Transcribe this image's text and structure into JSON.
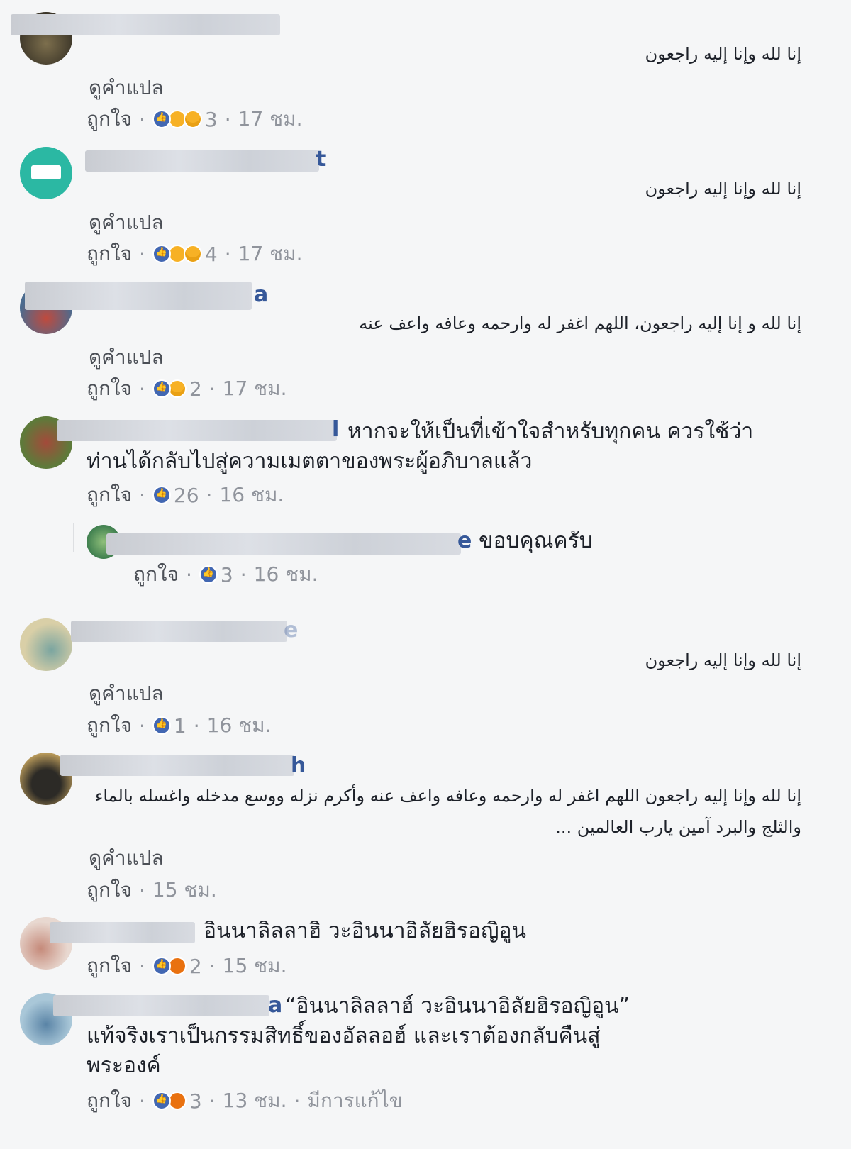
{
  "comments": [
    {
      "name_tail": "",
      "avatar_colors": [
        "#3b3528",
        "#7d6f4d"
      ],
      "arabic": "إنا لله وإنا إليه راجعون",
      "translate": "ดูคำแปล",
      "like": "ถูกใจ",
      "reactions": [
        "like",
        "haha",
        "sad"
      ],
      "count": "3",
      "time": "17 ชม."
    },
    {
      "name_tail": "t",
      "avatar_colors": [
        "#2bb8a3",
        "#ffffff"
      ],
      "arabic": "إنا لله وإنا إليه راجعون",
      "translate": "ดูคำแปล",
      "like": "ถูกใจ",
      "reactions": [
        "like",
        "haha",
        "sad"
      ],
      "count": "4",
      "time": "17 ชม."
    },
    {
      "name_tail": "a",
      "avatar_colors": [
        "#4b6b8f",
        "#c04a3d"
      ],
      "arabic": "إنا لله و إنا إليه راجعون، اللهم اغفر له وارحمه وعافه واعف عنه",
      "translate": "ดูคำแปล",
      "like": "ถูกใจ",
      "reactions": [
        "like",
        "sad"
      ],
      "count": "2",
      "time": "17 ชม."
    },
    {
      "name_tail": "l",
      "avatar_colors": [
        "#5e7a3a",
        "#a34a3a"
      ],
      "text": "หากจะให้เป็นที่เข้าใจสำหรับทุกคน ควรใช้ว่า ท่านได้กลับไปสู่ความเมตตาของพระผู้อภิบาลแล้ว",
      "like": "ถูกใจ",
      "reactions": [
        "like"
      ],
      "count": "26",
      "time": "16 ชม.",
      "reply": {
        "name_tail": "e",
        "text": "ขอบคุณครับ",
        "like": "ถูกใจ",
        "reactions": [
          "like"
        ],
        "count": "3",
        "time": "16 ชม."
      }
    },
    {
      "name_tail": "e",
      "avatar_colors": [
        "#d9cfa7",
        "#7aa5a0"
      ],
      "arabic": "إنا لله وإنا إليه راجعون",
      "translate": "ดูคำแปล",
      "like": "ถูกใจ",
      "reactions": [
        "like"
      ],
      "count": "1",
      "time": "16 ชม."
    },
    {
      "name_tail": "h",
      "avatar_colors": [
        "#2c2a26",
        "#b99a5a"
      ],
      "arabic": "إنا لله وإنا إليه راجعون اللهم اغفر له وارحمه وعافه واعف عنه وأكرم نزله ووسع مدخله واغسله بالماء والثلج والبرد آمين يارب العالمين ...",
      "translate": "ดูคำแปล",
      "like": "ถูกใจ",
      "reactions": [],
      "count": "",
      "time": "15 ชม."
    },
    {
      "name_tail": "",
      "avatar_colors": [
        "#e8d8d0",
        "#c58a7a"
      ],
      "text": "อินนาลิลลาฮิ วะอินนาอิลัยฮิรอญิอูน",
      "like": "ถูกใจ",
      "reactions": [
        "like",
        "angry"
      ],
      "count": "2",
      "time": "15 ชม."
    },
    {
      "name_tail": "a",
      "avatar_colors": [
        "#a9c7d8",
        "#5a84a6"
      ],
      "text": "“อินนาลิลลาฮ์ วะอินนาอิลัยฮิรอญิอูน” แท้จริงเราเป็นกรรมสิทธิ์ของอัลลอฮ์ และเราต้องกลับคืนสู่พระองค์",
      "like": "ถูกใจ",
      "reactions": [
        "like",
        "angry"
      ],
      "count": "3",
      "time": "13 ชม.",
      "edited": "มีการแก้ไข"
    }
  ]
}
